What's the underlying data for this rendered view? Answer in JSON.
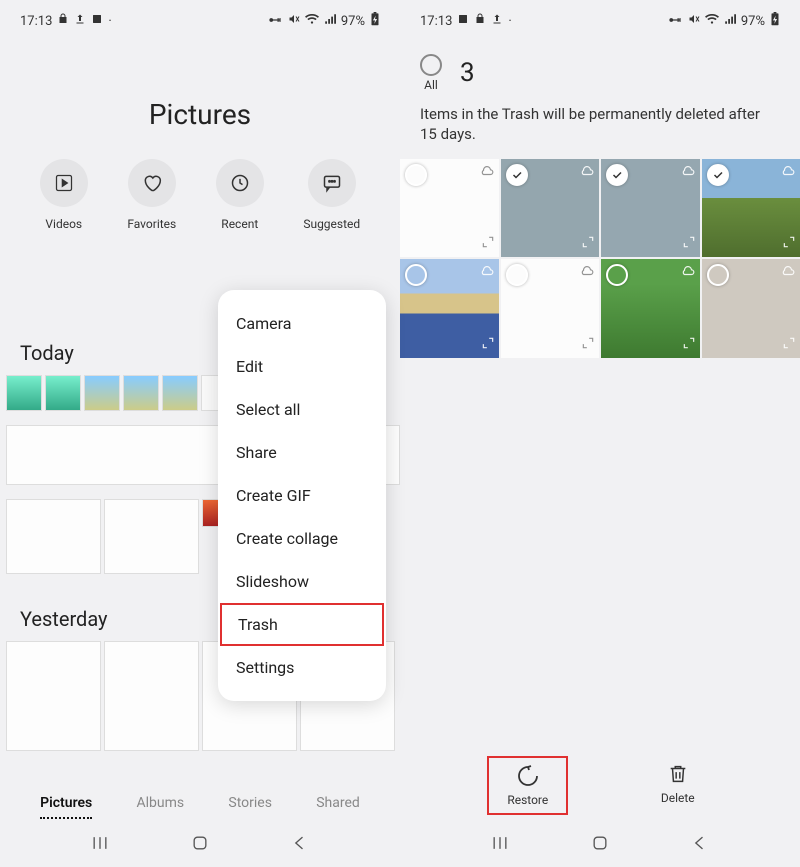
{
  "status": {
    "time": "17:13",
    "battery": "97%"
  },
  "left": {
    "title": "Pictures",
    "categories": [
      {
        "name": "videos",
        "label": "Videos"
      },
      {
        "name": "favorites",
        "label": "Favorites"
      },
      {
        "name": "recent",
        "label": "Recent"
      },
      {
        "name": "suggested",
        "label": "Suggested"
      }
    ],
    "sections": {
      "today": "Today",
      "yesterday": "Yesterday"
    },
    "tabs": {
      "pictures": "Pictures",
      "albums": "Albums",
      "stories": "Stories",
      "shared": "Shared"
    },
    "menu": {
      "camera": "Camera",
      "edit": "Edit",
      "select_all": "Select all",
      "share": "Share",
      "create_gif": "Create GIF",
      "create_collage": "Create collage",
      "slideshow": "Slideshow",
      "trash": "Trash",
      "settings": "Settings"
    }
  },
  "right": {
    "select_all_label": "All",
    "selected_count": "3",
    "trash_message": "Items in the Trash will be permanently deleted after 15 days.",
    "actions": {
      "restore": "Restore",
      "delete": "Delete"
    },
    "thumbnails_selected": [
      false,
      true,
      true,
      true,
      false,
      false,
      false,
      false
    ]
  }
}
